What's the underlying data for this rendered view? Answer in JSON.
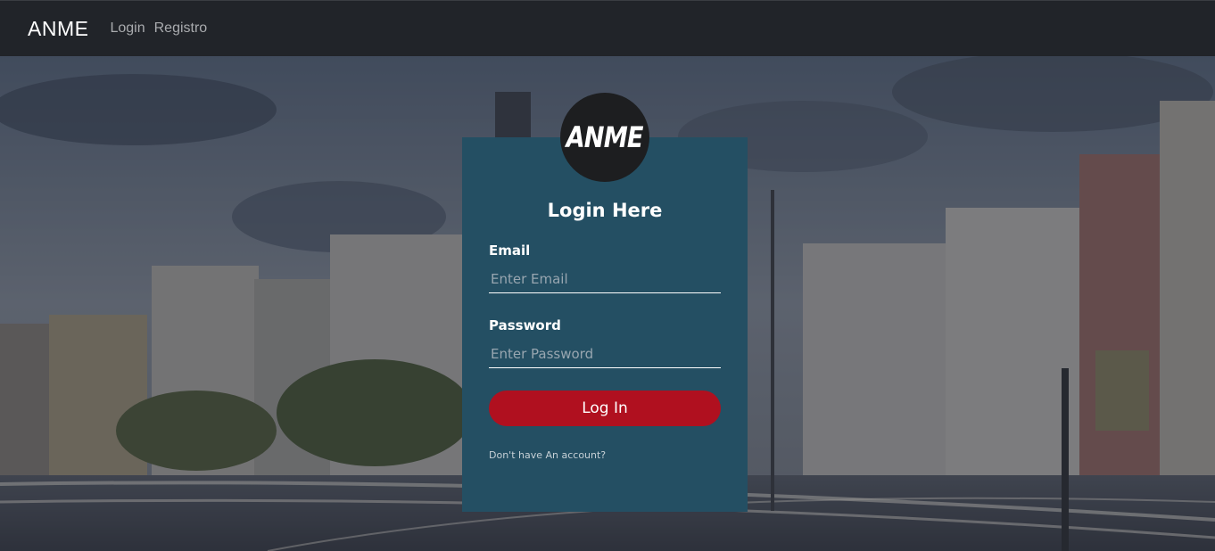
{
  "navbar": {
    "brand": "ANME",
    "links": [
      "Login",
      "Registro"
    ]
  },
  "login": {
    "logo_text": "ANME",
    "title": "Login Here",
    "email_label": "Email",
    "email_placeholder": "Enter Email",
    "password_label": "Password",
    "password_placeholder": "Enter Password",
    "button_label": "Log In",
    "register_link": "Don't have An account?"
  },
  "colors": {
    "navbar_bg": "#212429",
    "login_box_bg": "#244f63",
    "button_bg": "#b0101f",
    "avatar_bg": "#1d1e20"
  }
}
